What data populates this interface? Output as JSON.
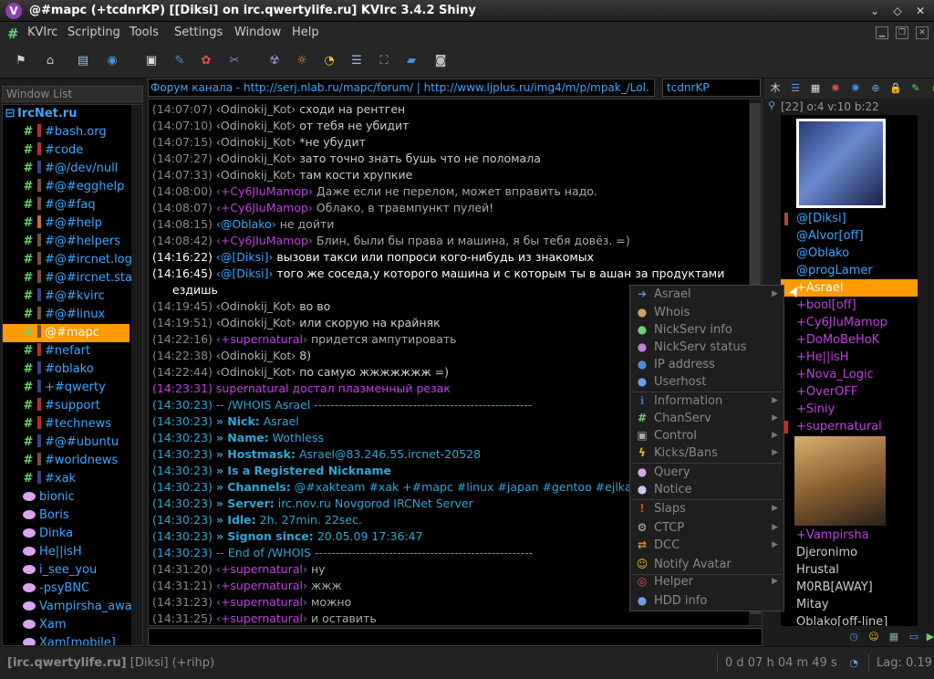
{
  "window": {
    "title": "@#mapc (+tcdnrKP) [[Diksi] on irc.qwertylife.ru] KVIrc 3.4.2 Shiny",
    "app_icon_letter": "V"
  },
  "menu": [
    "KVIrc",
    "Scripting",
    "Tools",
    "Settings",
    "Window",
    "Help"
  ],
  "toolbar_icons": [
    "connect-icon",
    "server-icon",
    "book-icon",
    "irc-icon",
    "options-icon",
    "wrench-icon",
    "theme-icon",
    "tools-icon",
    "mask-icon",
    "sun-icon",
    "timer-icon",
    "notes-icon",
    "fullscreen-icon",
    "folder-icon",
    "screenshot-icon"
  ],
  "window_list": {
    "header": "Window List",
    "network": "IrcNet.ru",
    "channels": [
      "#bash.org",
      "#code",
      "#@/dev/null",
      "#@#egghelp",
      "#@#faq",
      "#@#help",
      "#@#helpers",
      "#@#ircnet.log",
      "#@#ircnet.stat",
      "#@#kvirc",
      "#@#linux",
      "@#mapc",
      "#nefart",
      "#oblako",
      "+#qwerty",
      "#support",
      "#technews",
      "#@#ubuntu",
      "#worldnews",
      "#xak"
    ],
    "queries": [
      "bionic",
      "Boris",
      "Dinka",
      "He||isH",
      "i_see_you",
      "-psyBNC",
      "Vampirsha_away",
      "Xam",
      "Xam[mobile]"
    ],
    "selected": "@#mapc"
  },
  "topic": "Форум канала - http://serj.nlab.ru/mapc/forum/ | http://www.ljplus.ru/img4/m/p/mpak_/Lol.",
  "nick": "tcdnrKP",
  "chat": [
    {
      "t": "(14:07:07)",
      "n": "‹Odinokij_Kot›",
      "m": " сходи на рентген",
      "s": "gray"
    },
    {
      "t": "(14:07:10)",
      "n": "‹Odinokij_Kot›",
      "m": " от тебя не убидит",
      "s": "gray"
    },
    {
      "t": "(14:07:15)",
      "n": "‹Odinokij_Kot›",
      "m": " *не убудит",
      "s": "gray"
    },
    {
      "t": "(14:07:27)",
      "n": "‹Odinokij_Kot›",
      "m": " зато точно знать бушь что не поломала",
      "s": "gray"
    },
    {
      "t": "(14:07:33)",
      "n": "‹Odinokij_Kot›",
      "m": " там кости хрупкие",
      "s": "gray"
    },
    {
      "t": "(14:08:00)",
      "n": "‹+Cy6JIuMamop›",
      "m": " Даже если не перелом, может вправить надо.",
      "s": "purple"
    },
    {
      "t": "(14:08:07)",
      "n": "‹+Cy6JIuMamop›",
      "m": " Облако, в травмпункт пулей!",
      "s": "purple"
    },
    {
      "t": "(14:08:15)",
      "n": "‹@Oblako›",
      "m": " не дойти",
      "s": "cyan"
    },
    {
      "t": "(14:08:42)",
      "n": "‹+Cy6JIuMamop›",
      "m": " Блин, были бы права и машина, я бы тебя довёз. =)",
      "s": "purple"
    },
    {
      "t": "(14:16:22)",
      "n": "‹@[Diksi]›",
      "m": " вызови такси или попроси кого-нибудь из знакомых",
      "s": "self"
    },
    {
      "t": "(14:16:45)",
      "n": "‹@[Diksi]›",
      "m": " того же соседа,у которого машина и с которым ты в ашан за продуктами",
      "s": "self"
    },
    {
      "t": "",
      "n": "",
      "m": "ездишь",
      "s": "selfcont"
    },
    {
      "t": "(14:19:45)",
      "n": "‹Odinokij_Kot›",
      "m": " во во",
      "s": "gray"
    },
    {
      "t": "(14:19:51)",
      "n": "‹Odinokij_Kot›",
      "m": " или скорую на крайняк",
      "s": "gray"
    },
    {
      "t": "(14:22:16)",
      "n": "‹+supernatural›",
      "m": " придется ампутировать",
      "s": "purple"
    },
    {
      "t": "(14:22:38)",
      "n": "‹Odinokij_Kot›",
      "m": " 8)",
      "s": "gray"
    },
    {
      "t": "(14:22:44)",
      "n": "‹Odinokij_Kot›",
      "m": " по самую жжжжжжж =)",
      "s": "gray"
    },
    {
      "t": "(14:23:31)",
      "n": "supernatural",
      "m": " достал плазменный резак",
      "s": "action"
    },
    {
      "t": "(14:30:23)",
      "n": "-- /WHOIS Asrael",
      "m": " -----------------------------------------------------",
      "s": "whois"
    },
    {
      "t": "(14:30:23)",
      "n": "» Nick:",
      "m": " Asrael",
      "s": "whoisf"
    },
    {
      "t": "(14:30:23)",
      "n": "» Name:",
      "m": " Wothless",
      "s": "whoisf"
    },
    {
      "t": "(14:30:23)",
      "n": "» Hostmask:",
      "m": " Asrael@83.246.55.ircnet-20528",
      "s": "whoisf"
    },
    {
      "t": "(14:30:23)",
      "n": "» Is a Registered Nickname",
      "m": "",
      "s": "whoisf"
    },
    {
      "t": "(14:30:23)",
      "n": "» Channels:",
      "m": " @#xakteam #xak +#mapc #linux #japan #gentoo #ejlka #",
      "s": "whoisf"
    },
    {
      "t": "(14:30:23)",
      "n": "» Server:",
      "m": " irc.nov.ru Novgorod IRCNet Server",
      "s": "whoisf"
    },
    {
      "t": "(14:30:23)",
      "n": "» Idle:",
      "m": " 2h. 27min. 22sec.",
      "s": "whoisf"
    },
    {
      "t": "(14:30:23)",
      "n": "» Signon since:",
      "m": " 20.05.09 17:36:47",
      "s": "whoisf"
    },
    {
      "t": "(14:30:23)",
      "n": "-- End of /WHOIS",
      "m": " -----------------------------------------------------",
      "s": "whois"
    },
    {
      "t": "(14:31:20)",
      "n": "‹+supernatural›",
      "m": " ну",
      "s": "purple"
    },
    {
      "t": "(14:31:21)",
      "n": "‹+supernatural›",
      "m": " жжж",
      "s": "purple"
    },
    {
      "t": "(14:31:23)",
      "n": "‹+supernatural›",
      "m": " можно",
      "s": "purple"
    },
    {
      "t": "(14:31:25)",
      "n": "‹+supernatural›",
      "m": " и оставить",
      "s": "purple"
    }
  ],
  "context_menu": [
    {
      "label": "Asrael",
      "icon": "arrow-icon",
      "color": "#5a8ad8",
      "sub": true
    },
    {
      "label": "Whois",
      "icon": "user-icon",
      "color": "#d8a060",
      "sub": false
    },
    {
      "label": "NickServ info",
      "icon": "bubble-icon",
      "color": "#6bd36b",
      "sub": false
    },
    {
      "label": "NickServ status",
      "icon": "bubble-icon",
      "color": "#c080e0",
      "sub": false
    },
    {
      "label": "IP address",
      "icon": "globe-icon",
      "color": "#4a90e0",
      "sub": false
    },
    {
      "label": "Userhost",
      "icon": "globe-icon",
      "color": "#6aa0e8",
      "sub": false
    },
    {
      "label": "Information",
      "icon": "info-icon",
      "color": "#3a70c0",
      "sub": true
    },
    {
      "label": "ChanServ",
      "icon": "hash-icon",
      "color": "#6bd36b",
      "sub": true
    },
    {
      "label": "Control",
      "icon": "terminal-icon",
      "color": "#aaaaaa",
      "sub": true
    },
    {
      "label": "Kicks/Bans",
      "icon": "lightning-icon",
      "color": "#f0c020",
      "sub": true
    },
    {
      "label": "Query",
      "icon": "bubble-icon",
      "color": "#d9a5f0",
      "sub": false
    },
    {
      "label": "Notice",
      "icon": "bubble-icon",
      "color": "#c8c8f0",
      "sub": false
    },
    {
      "label": "Slaps",
      "icon": "warning-icon",
      "color": "#e04020",
      "sub": true
    },
    {
      "label": "CTCP",
      "icon": "gear-icon",
      "color": "#bbbbbb",
      "sub": true
    },
    {
      "label": "DCC",
      "icon": "dcc-icon",
      "color": "#e08040",
      "sub": true
    },
    {
      "label": "Notify Avatar",
      "icon": "smiley-icon",
      "color": "#f0c020",
      "sub": false
    },
    {
      "label": "Helper",
      "icon": "lifebuoy-icon",
      "color": "#e05050",
      "sub": true
    },
    {
      "label": "HDD info",
      "icon": "disk-icon",
      "color": "#6aa0e8",
      "sub": false
    }
  ],
  "user_stats": "[22] o:4 v:10 b:22",
  "users": [
    {
      "n": "@[Diksi]",
      "c": "#3aa7ff",
      "a": "#a05030"
    },
    {
      "n": "@Alvor[off]",
      "c": "#3aa7ff"
    },
    {
      "n": "@Oblako",
      "c": "#3aa7ff"
    },
    {
      "n": "@progLamer",
      "c": "#3aa7ff"
    },
    {
      "n": "+Asrael",
      "c": "#ffffff",
      "sel": true
    },
    {
      "n": "+bool[off]",
      "c": "#c040e0"
    },
    {
      "n": "+Cy6JIuMamop",
      "c": "#c040e0"
    },
    {
      "n": "+DoMoBeHoK",
      "c": "#c040e0"
    },
    {
      "n": "+He||isH",
      "c": "#c040e0"
    },
    {
      "n": "+Nova_Logic",
      "c": "#c040e0"
    },
    {
      "n": "+OverOFF",
      "c": "#c040e0"
    },
    {
      "n": "+Siniy",
      "c": "#c040e0"
    },
    {
      "n": "+supernatural",
      "c": "#c040e0",
      "a": "#e02020"
    },
    {
      "n": "+Vampirsha",
      "c": "#c040e0"
    },
    {
      "n": "Djeronimo",
      "c": "#cccccc"
    },
    {
      "n": "Hrustal",
      "c": "#cccccc"
    },
    {
      "n": "M0RB[AWAY]",
      "c": "#cccccc"
    },
    {
      "n": "Mitay",
      "c": "#cccccc"
    },
    {
      "n": "Oblako[off-line]",
      "c": "#cccccc"
    }
  ],
  "status": {
    "server": "[irc.qwertylife.ru]",
    "nick": " [Diksi] (+rihp)",
    "uptime": "0 d 07 h 04 m 49 s",
    "lag": "Lag: 0.19"
  },
  "colors": {
    "accent": "#ff9a00",
    "op": "#3aa7ff",
    "voice": "#c040e0"
  }
}
